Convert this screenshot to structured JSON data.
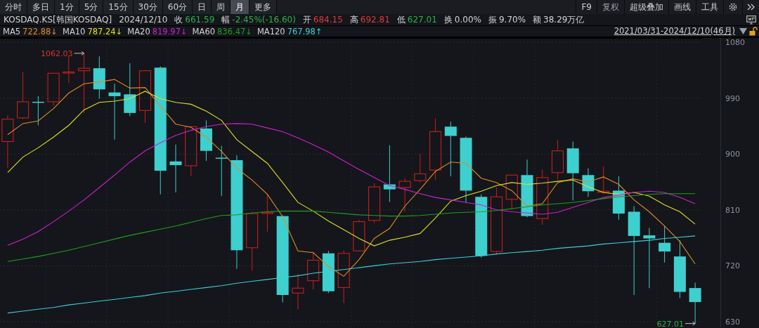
{
  "toolbar": {
    "tabs": [
      {
        "label": "分时",
        "selected": false
      },
      {
        "label": "多日",
        "selected": false
      },
      {
        "label": "1分",
        "selected": false
      },
      {
        "label": "5分",
        "selected": false
      },
      {
        "label": "15分",
        "selected": false
      },
      {
        "label": "30分",
        "selected": false
      },
      {
        "label": "60分",
        "selected": false
      },
      {
        "label": "日",
        "selected": false
      },
      {
        "label": "周",
        "selected": false
      },
      {
        "label": "月",
        "selected": true
      },
      {
        "label": "更多",
        "selected": false
      }
    ],
    "tools": [
      "F9",
      "复权",
      "超级叠加",
      "画线",
      "工具"
    ]
  },
  "quote": {
    "symbol": "KOSDAQ.KS[韩国KOSDAQ]",
    "date": "2024/12/10",
    "fields": [
      {
        "label": "收",
        "value": "661.59",
        "color": "#2db24a"
      },
      {
        "label": "幅",
        "value": "-2.45%(-16.60)",
        "color": "#2db24a"
      },
      {
        "label": "开",
        "value": "684.15",
        "color": "#e03a3a"
      },
      {
        "label": "高",
        "value": "692.81",
        "color": "#e03a3a"
      },
      {
        "label": "低",
        "value": "627.01",
        "color": "#2db24a"
      },
      {
        "label": "换",
        "value": "0.00%",
        "color": "#d4d4d4"
      },
      {
        "label": "振",
        "value": "9.70%",
        "color": "#d4d4d4"
      },
      {
        "label": "额",
        "value": "38.29万亿",
        "color": "#d4d4d4"
      }
    ]
  },
  "ma_legend": [
    {
      "value": "722.88↓"
    },
    {
      "value": "787.24↓"
    },
    {
      "value": "819.97↓"
    },
    {
      "value": "836.47↓"
    },
    {
      "value": "767.98↑"
    }
  ],
  "range": {
    "text": "2021/03/31-2024/12/10(46月)"
  },
  "chart_data": {
    "type": "candlestick",
    "grid": true,
    "ylim": [
      630,
      1080
    ],
    "yticks": [
      630,
      720,
      810,
      900,
      990,
      1080
    ],
    "ohlc": [
      [
        920,
        962,
        878,
        956
      ],
      [
        958,
        1032,
        956,
        984
      ],
      [
        984,
        993,
        946,
        983
      ],
      [
        984,
        1030,
        978,
        1030
      ],
      [
        1031,
        1058,
        1014,
        1032
      ],
      [
        1034,
        1062.03,
        966,
        1038
      ],
      [
        1038,
        1057,
        989,
        1004
      ],
      [
        999,
        1013,
        923,
        993
      ],
      [
        996,
        1046,
        961,
        966
      ],
      [
        970,
        1035,
        950,
        1034
      ],
      [
        1039,
        1041,
        835,
        873
      ],
      [
        888,
        915,
        838,
        882
      ],
      [
        881,
        945,
        864,
        944
      ],
      [
        941,
        954,
        889,
        905
      ],
      [
        894,
        913,
        832,
        893
      ],
      [
        890,
        898,
        715,
        745
      ],
      [
        749,
        807,
        712,
        804
      ],
      [
        804,
        836,
        775,
        806
      ],
      [
        800,
        801,
        661,
        673
      ],
      [
        676,
        707,
        650,
        684
      ],
      [
        696,
        743,
        682,
        729
      ],
      [
        740,
        744,
        676,
        679
      ],
      [
        685,
        745,
        660,
        740
      ],
      [
        744,
        794,
        743,
        791
      ],
      [
        793,
        853,
        789,
        847
      ],
      [
        851,
        914,
        823,
        843
      ],
      [
        846,
        861,
        807,
        856
      ],
      [
        857,
        900,
        854,
        868
      ],
      [
        874,
        957,
        858,
        936
      ],
      [
        944,
        952,
        864,
        929
      ],
      [
        926,
        928,
        822,
        841
      ],
      [
        831,
        835,
        733,
        736
      ],
      [
        743,
        846,
        738,
        831
      ],
      [
        827,
        866,
        810,
        866
      ],
      [
        866,
        891,
        798,
        800
      ],
      [
        796,
        875,
        786,
        862
      ],
      [
        870,
        923,
        859,
        905
      ],
      [
        909,
        920,
        825,
        869
      ],
      [
        866,
        877,
        831,
        840
      ],
      [
        838,
        880,
        836,
        840
      ],
      [
        841,
        864,
        794,
        804
      ],
      [
        807,
        816,
        673,
        768
      ],
      [
        769,
        781,
        684,
        764
      ],
      [
        757,
        784,
        725,
        743
      ],
      [
        735,
        761,
        668,
        678
      ],
      [
        684.15,
        692.81,
        627.01,
        661.59
      ]
    ],
    "series": [
      {
        "name": "MA5",
        "type": "line",
        "color": "#e08a2a",
        "values": [
          931,
          949,
          953,
          973,
          998,
          1013,
          1016,
          1020,
          1006,
          1007,
          977,
          948,
          943,
          927,
          904,
          877,
          858,
          835,
          799,
          744,
          741,
          719,
          703,
          730,
          764,
          780,
          816,
          843,
          872,
          887,
          885,
          861,
          854,
          841,
          816,
          820,
          854,
          860,
          855,
          863,
          851,
          826,
          807,
          784,
          759,
          723
        ]
      },
      {
        "name": "MA10",
        "type": "line",
        "color": "#e2e022",
        "values": [
          870,
          895,
          910,
          927,
          946,
          971,
          983,
          985,
          989,
          1001,
          989,
          983,
          980,
          969,
          954,
          923,
          904,
          885,
          854,
          822,
          808,
          792,
          778,
          764,
          752,
          761,
          766,
          772,
          797,
          824,
          833,
          840,
          849,
          854,
          851,
          853,
          856,
          858,
          847,
          838,
          835,
          838,
          832,
          818,
          807,
          787
        ]
      },
      {
        "name": "MA20",
        "type": "line",
        "color": "#d020d0",
        "values": [
          753,
          763,
          775,
          791,
          808,
          826,
          846,
          866,
          887,
          905,
          918,
          930,
          938,
          944,
          948,
          949,
          948,
          942,
          936,
          926,
          915,
          903,
          889,
          875,
          862,
          849,
          843,
          836,
          830,
          826,
          822,
          818,
          810,
          807,
          805,
          803,
          806,
          814,
          822,
          830,
          834,
          838,
          840,
          838,
          830,
          820
        ]
      },
      {
        "name": "MA60",
        "type": "line",
        "color": "#1f9e1f",
        "values": [
          727,
          731,
          735,
          740,
          745,
          751,
          757,
          763,
          769,
          774,
          779,
          784,
          790,
          796,
          801,
          802,
          805,
          807,
          808,
          808,
          808,
          806,
          804,
          802,
          801,
          800,
          800,
          801,
          803,
          805,
          806,
          807,
          809,
          812,
          815,
          818,
          820,
          822,
          825,
          828,
          831,
          833,
          835,
          836,
          836,
          836
        ]
      },
      {
        "name": "MA120",
        "type": "line",
        "color": "#40ccd6",
        "values": [
          644,
          647,
          650,
          653,
          657,
          660,
          663,
          666,
          669,
          672,
          676,
          679,
          682,
          685,
          688,
          692,
          695,
          698,
          701,
          704,
          708,
          711,
          714,
          717,
          720,
          723,
          725,
          727,
          730,
          732,
          734,
          736,
          739,
          741,
          743,
          745,
          748,
          750,
          752,
          755,
          757,
          759,
          761,
          764,
          766,
          768
        ]
      }
    ],
    "annotations": [
      "1062.03",
      "627.01"
    ]
  }
}
